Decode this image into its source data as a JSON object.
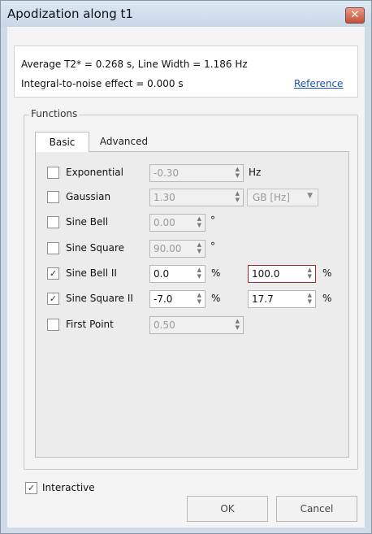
{
  "window": {
    "title": "Apodization along t1",
    "close_glyph": "✕"
  },
  "info": {
    "line1": "Average T2* = 0.268 s, Line Width = 1.186 Hz",
    "line2": "Integral-to-noise effect = 0.000 s",
    "reference_label": "Reference"
  },
  "functions": {
    "group_label": "Functions",
    "tabs": [
      {
        "label": "Basic",
        "active": true
      },
      {
        "label": "Advanced",
        "active": false
      }
    ],
    "rows": [
      {
        "label": "Exponential",
        "checked": false,
        "value1": "-0.30",
        "unit1": "Hz",
        "enabled": false
      },
      {
        "label": "Gaussian",
        "checked": false,
        "value1": "1.30",
        "combo": "GB [Hz]",
        "enabled": false
      },
      {
        "label": "Sine Bell",
        "checked": false,
        "value1": "0.00",
        "unit1": "°",
        "enabled": false
      },
      {
        "label": "Sine Square",
        "checked": false,
        "value1": "90.00",
        "unit1": "°",
        "enabled": false
      },
      {
        "label": "Sine Bell II",
        "checked": true,
        "value1": "0.0",
        "unit1": "%",
        "value2": "100.0",
        "unit2": "%",
        "enabled": true
      },
      {
        "label": "Sine Square II",
        "checked": true,
        "value1": "-7.0",
        "unit1": "%",
        "value2": "17.7",
        "unit2": "%",
        "enabled": true
      },
      {
        "label": "First Point",
        "checked": false,
        "value1": "0.50",
        "enabled": false
      }
    ]
  },
  "interactive": {
    "label": "Interactive",
    "checked": true
  },
  "buttons": {
    "ok": "OK",
    "cancel": "Cancel"
  },
  "glyphs": {
    "check": "✓",
    "spin_up": "▲",
    "spin_down": "▼",
    "combo_caret": "▼"
  }
}
